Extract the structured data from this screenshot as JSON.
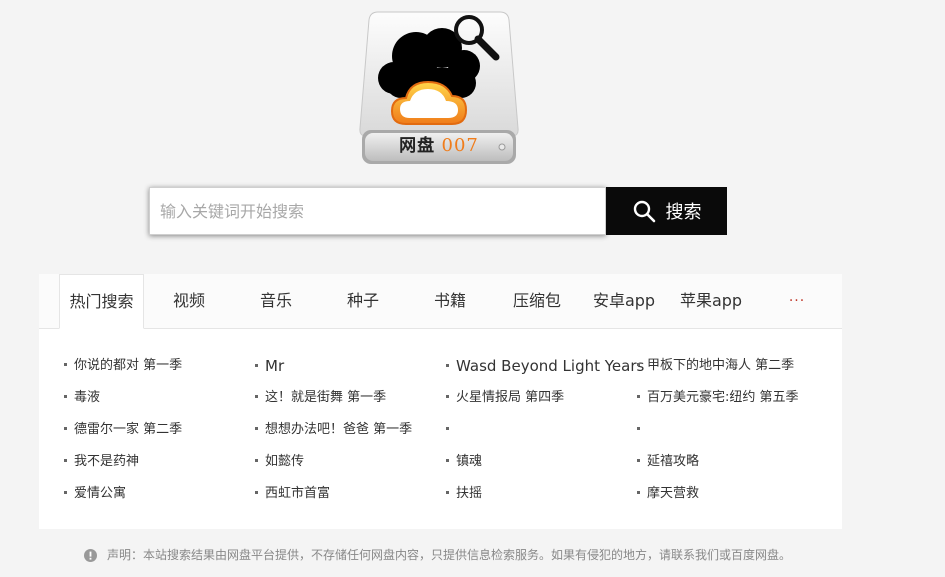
{
  "logo": {
    "text_cn": "网盘",
    "text_num": "007"
  },
  "search": {
    "placeholder": "输入关键词开始搜索",
    "value": "",
    "button_label": "搜索",
    "button_icon": "search-icon"
  },
  "tabs": [
    {
      "label": "热门搜索",
      "active": true
    },
    {
      "label": "视频"
    },
    {
      "label": "音乐"
    },
    {
      "label": "种子"
    },
    {
      "label": "书籍"
    },
    {
      "label": "压缩包"
    },
    {
      "label": "安卓app"
    },
    {
      "label": "苹果app"
    },
    {
      "label": "···"
    }
  ],
  "hot_columns": [
    [
      "你说的都对 第一季",
      "毒液",
      "德雷尔一家 第二季",
      "我不是药神",
      "爱情公寓"
    ],
    [
      "Mr",
      "这！就是街舞 第一季",
      "想想办法吧！爸爸 第一季",
      "如懿传",
      "西虹市首富"
    ],
    [
      "Wasd Beyond Light Years",
      "火星情报局 第四季",
      "",
      "镇魂",
      "扶摇"
    ],
    [
      "甲板下的地中海人 第二季",
      "百万美元豪宅:纽约 第五季",
      "",
      "延禧攻略",
      "摩天营救"
    ]
  ],
  "notice": {
    "icon": "info-icon",
    "text": "声明：本站搜索结果由网盘平台提供，不存储任何网盘内容，只提供信息检索服务。如果有侵犯的地方，请联系我们或百度网盘。"
  },
  "colors": {
    "accent_orange": "#f07c1a",
    "button_black": "#0a0a0a",
    "page_bg": "#f4f4f4"
  }
}
